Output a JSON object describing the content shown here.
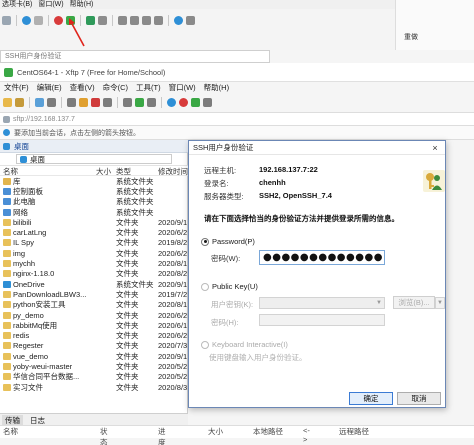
{
  "background_window": {
    "menu": [
      "选项卡(B)",
      "窗口(W)",
      "帮助(H)"
    ],
    "right_label": "重做"
  },
  "ssh_strip": {
    "label": "SSH用户身份验证"
  },
  "xftp": {
    "title": "CentOS64-1 - Xftp 7 (Free for Home/School)",
    "menu": [
      "文件(F)",
      "编辑(E)",
      "查看(V)",
      "命令(C)",
      "工具(T)",
      "窗口(W)",
      "帮助(H)"
    ],
    "address_placeholder": "sftp://192.168.137.7",
    "hint": "要添加当前会话，点击左侧的箭头按钮。"
  },
  "left_pane": {
    "tab_label": "桌面",
    "path": "桌面",
    "columns": [
      "名称",
      "大小",
      "类型",
      "修改时间"
    ],
    "files": [
      {
        "name": "库",
        "size": "",
        "type": "系统文件夹",
        "modified": "",
        "icon": "library"
      },
      {
        "name": "控制面板",
        "size": "",
        "type": "系统文件夹",
        "modified": "",
        "icon": "control-panel"
      },
      {
        "name": "此电脑",
        "size": "",
        "type": "系统文件夹",
        "modified": "",
        "icon": "computer"
      },
      {
        "name": "网络",
        "size": "",
        "type": "系统文件夹",
        "modified": "",
        "icon": "network"
      },
      {
        "name": "bilibili",
        "size": "",
        "type": "文件夹",
        "modified": "2020/9/1",
        "icon": "folder"
      },
      {
        "name": "carLatLng",
        "size": "",
        "type": "文件夹",
        "modified": "2020/6/2",
        "icon": "folder"
      },
      {
        "name": "IL Spy",
        "size": "",
        "type": "文件夹",
        "modified": "2019/8/2",
        "icon": "folder"
      },
      {
        "name": "img",
        "size": "",
        "type": "文件夹",
        "modified": "2020/6/2",
        "icon": "folder"
      },
      {
        "name": "mychh",
        "size": "",
        "type": "文件夹",
        "modified": "2020/8/1",
        "icon": "folder"
      },
      {
        "name": "nginx-1.18.0",
        "size": "",
        "type": "文件夹",
        "modified": "2020/8/2",
        "icon": "folder"
      },
      {
        "name": "OneDrive",
        "size": "",
        "type": "系统文件夹",
        "modified": "2020/9/1",
        "icon": "cloud"
      },
      {
        "name": "PanDownloadLBW3...",
        "size": "",
        "type": "文件夹",
        "modified": "2019/7/2",
        "icon": "folder"
      },
      {
        "name": "python安装工具",
        "size": "",
        "type": "文件夹",
        "modified": "2020/8/1",
        "icon": "folder"
      },
      {
        "name": "py_demo",
        "size": "",
        "type": "文件夹",
        "modified": "2020/6/2",
        "icon": "folder"
      },
      {
        "name": "rabbitMq使用",
        "size": "",
        "type": "文件夹",
        "modified": "2020/6/1",
        "icon": "folder"
      },
      {
        "name": "redis",
        "size": "",
        "type": "文件夹",
        "modified": "2020/6/2",
        "icon": "folder"
      },
      {
        "name": "Regester",
        "size": "",
        "type": "文件夹",
        "modified": "2020/7/3",
        "icon": "folder"
      },
      {
        "name": "vue_demo",
        "size": "",
        "type": "文件夹",
        "modified": "2020/9/1",
        "icon": "folder"
      },
      {
        "name": "yoby-weui-master",
        "size": "",
        "type": "文件夹",
        "modified": "2020/5/2",
        "icon": "folder"
      },
      {
        "name": "华信合同平台数据...",
        "size": "",
        "type": "文件夹",
        "modified": "2020/5/2",
        "icon": "folder"
      },
      {
        "name": "实习文件",
        "size": "",
        "type": "文件夹",
        "modified": "2020/8/3",
        "icon": "folder"
      }
    ]
  },
  "log_tabs": [
    "传输",
    "日志"
  ],
  "transfer_columns": [
    "名称",
    "状态",
    "进度",
    "大小",
    "本地路径",
    "<->",
    "远程路径"
  ],
  "dialog": {
    "title": "SSH用户身份验证",
    "close_glyph": "×",
    "remote_host_label": "远程主机:",
    "remote_host_value": "192.168.137.7:22",
    "login_name_label": "登录名:",
    "login_name_value": "chenhh",
    "server_type_label": "服务器类型:",
    "server_type_value": "SSH2, OpenSSH_7.4",
    "instruction": "请在下面选择恰当的身份验证方法并提供登录所需的信息。",
    "password_option": "Password(P)",
    "password_label": "密码(W):",
    "password_value": "●●●●●●●●●●●●●",
    "publickey_option": "Public Key(U)",
    "user_key_label": "用户密钥(K):",
    "passphrase_label": "密码(H):",
    "browse_label": "浏览(B)...",
    "keyboard_option": "Keyboard Interactive(I)",
    "keyboard_hint": "使用键盘输入用户身份验证。",
    "ok_label": "确定",
    "cancel_label": "取消"
  }
}
